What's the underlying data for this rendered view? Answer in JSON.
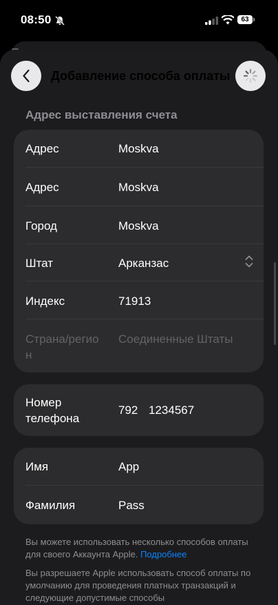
{
  "status_bar": {
    "time": "08:50",
    "battery": "63"
  },
  "nav": {
    "title": "Добавление способа оплаты"
  },
  "billing": {
    "header": "Адрес выставления счета",
    "rows": [
      {
        "label": "Адрес",
        "value": "Moskva"
      },
      {
        "label": "Адрес",
        "value": "Moskva"
      },
      {
        "label": "Город",
        "value": "Moskva"
      },
      {
        "label": "Штат",
        "value": "Арканзас"
      },
      {
        "label": "Индекс",
        "value": "71913"
      },
      {
        "label": "Страна/регио н",
        "value": "Соединенные Штаты"
      }
    ]
  },
  "phone": {
    "label": "Номер телефона",
    "code": "792",
    "number": "1234567"
  },
  "name": {
    "rows": [
      {
        "label": "Имя",
        "value": "App"
      },
      {
        "label": "Фамилия",
        "value": "Pass"
      }
    ]
  },
  "footer": {
    "text1": "Вы можете использовать несколько способов оплаты для своего Аккаунта Apple.",
    "link": "Подробнее",
    "text2": "Вы разрешаете Apple использовать способ оплаты по умолчанию для проведения платных транзакций и следующие допустимые способы"
  },
  "colors": {
    "accent": "#0a84ff",
    "card": "#2c2c2e",
    "sheet": "#1c1c1e"
  }
}
